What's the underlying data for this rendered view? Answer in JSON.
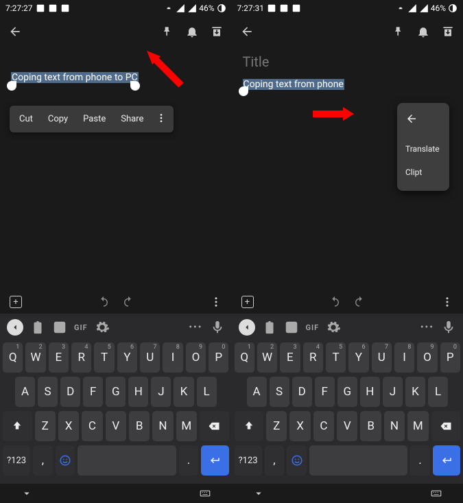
{
  "left": {
    "status": {
      "time": "7:27:27",
      "battery": "46%"
    },
    "popup": {
      "cut": "Cut",
      "copy": "Copy",
      "paste": "Paste",
      "share": "Share"
    },
    "note": {
      "selected": "Coping text from phone to PC"
    }
  },
  "right": {
    "status": {
      "time": "7:27:31",
      "battery": "46%"
    },
    "title_placeholder": "Title",
    "note": {
      "selected": "Coping text from phone"
    },
    "menu": {
      "translate": "Translate",
      "clipt": "Clipt"
    }
  },
  "keyboard": {
    "gif": "GIF",
    "row1": [
      "Q",
      "W",
      "E",
      "R",
      "T",
      "Y",
      "U",
      "I",
      "O",
      "P"
    ],
    "row1sup": [
      "1",
      "2",
      "3",
      "4",
      "5",
      "6",
      "7",
      "8",
      "9",
      "0"
    ],
    "row2": [
      "A",
      "S",
      "D",
      "F",
      "G",
      "H",
      "J",
      "K",
      "L"
    ],
    "row3": [
      "Z",
      "X",
      "C",
      "V",
      "B",
      "N",
      "M"
    ],
    "sym": "?123",
    "comma": ",",
    "period": "."
  }
}
